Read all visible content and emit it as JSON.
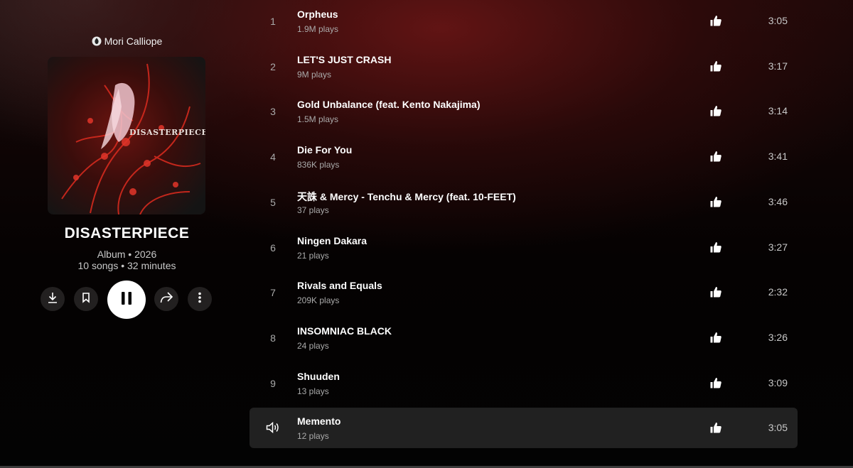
{
  "artist": {
    "name": "Mori Calliope",
    "icon": "artist-mic-icon"
  },
  "album": {
    "cover_text": "DISASTERPIECE",
    "title": "DISASTERPIECE",
    "type_year": "Album • 2026",
    "summary": "10 songs • 32 minutes"
  },
  "actions": {
    "download_icon": "download-icon",
    "save_icon": "bookmark-icon",
    "play_icon": "pause-icon",
    "share_icon": "share-icon",
    "more_icon": "more-vertical-icon"
  },
  "tracks": [
    {
      "num": "1",
      "title": "Orpheus",
      "plays": "1.9M plays",
      "duration": "3:05"
    },
    {
      "num": "2",
      "title": "LET'S JUST CRASH",
      "plays": "9M plays",
      "duration": "3:17"
    },
    {
      "num": "3",
      "title": "Gold Unbalance (feat. Kento Nakajima)",
      "plays": "1.5M plays",
      "duration": "3:14"
    },
    {
      "num": "4",
      "title": "Die For You",
      "plays": "836K plays",
      "duration": "3:41"
    },
    {
      "num": "5",
      "title": "天誅 & Mercy - Tenchu & Mercy (feat. 10-FEET)",
      "plays": "37 plays",
      "duration": "3:46"
    },
    {
      "num": "6",
      "title": "Ningen Dakara",
      "plays": "21 plays",
      "duration": "3:27"
    },
    {
      "num": "7",
      "title": "Rivals and Equals",
      "plays": "209K plays",
      "duration": "2:32"
    },
    {
      "num": "8",
      "title": "INSOMNIAC BLACK",
      "plays": "24 plays",
      "duration": "3:26"
    },
    {
      "num": "9",
      "title": "Shuuden",
      "plays": "13 plays",
      "duration": "3:09"
    },
    {
      "num": "",
      "title": "Memento",
      "plays": "12 plays",
      "duration": "3:05",
      "now_playing": true
    }
  ],
  "colors": {
    "accent_bg": "#6e1616",
    "active_row": "#212121",
    "secondary_text": "#aaaaaa"
  }
}
